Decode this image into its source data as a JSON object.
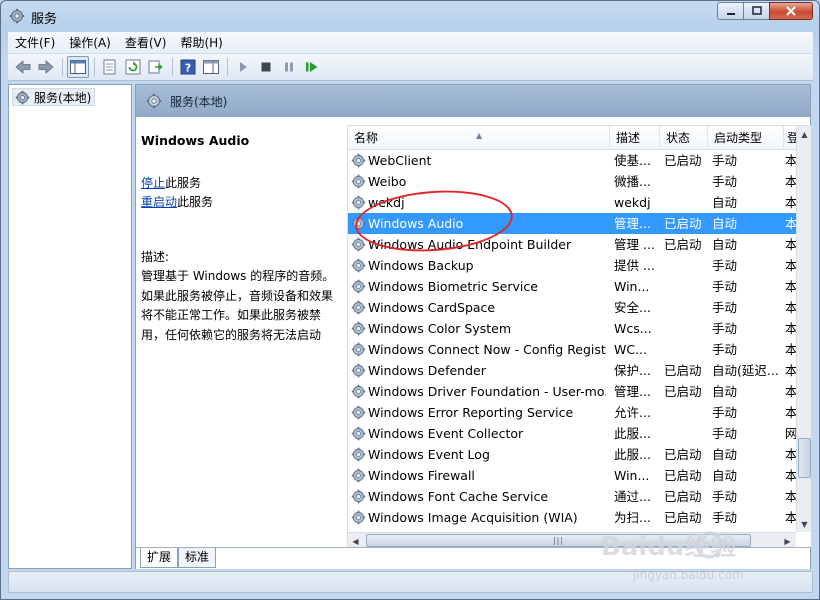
{
  "window": {
    "title": "服务"
  },
  "menu": [
    "文件(F)",
    "操作(A)",
    "查看(V)",
    "帮助(H)"
  ],
  "tree": {
    "root_label": "服务(本地)"
  },
  "right_header": {
    "label": "服务(本地)"
  },
  "detail": {
    "service_title": "Windows Audio",
    "stop_link": "停止",
    "stop_suffix": "此服务",
    "restart_link": "重启动",
    "restart_suffix": "此服务",
    "desc_label": "描述:",
    "desc_text": "管理基于 Windows 的程序的音频。如果此服务被停止，音频设备和效果将不能正常工作。如果此服务被禁用，任何依赖它的服务将无法启动"
  },
  "columns": {
    "name": "名称",
    "description": "描述",
    "status": "状态",
    "startup": "启动类型",
    "logon": "登"
  },
  "services": [
    {
      "name": "WebClient",
      "desc": "使基...",
      "status": "已启动",
      "startup": "手动",
      "logon": "本"
    },
    {
      "name": "Weibo",
      "desc": "微播...",
      "status": "",
      "startup": "手动",
      "logon": "本"
    },
    {
      "name": "wekdj",
      "desc": "wekdj",
      "status": "",
      "startup": "自动",
      "logon": "本"
    },
    {
      "name": "Windows Audio",
      "desc": "管理...",
      "status": "已启动",
      "startup": "自动",
      "logon": "本",
      "selected": true
    },
    {
      "name": "Windows Audio Endpoint Builder",
      "desc": "管理 ...",
      "status": "已启动",
      "startup": "自动",
      "logon": "本"
    },
    {
      "name": "Windows Backup",
      "desc": "提供 ...",
      "status": "",
      "startup": "手动",
      "logon": "本"
    },
    {
      "name": "Windows Biometric Service",
      "desc": "Win...",
      "status": "",
      "startup": "手动",
      "logon": "本"
    },
    {
      "name": "Windows CardSpace",
      "desc": "安全...",
      "status": "",
      "startup": "手动",
      "logon": "本"
    },
    {
      "name": "Windows Color System",
      "desc": "Wcs...",
      "status": "",
      "startup": "手动",
      "logon": "本"
    },
    {
      "name": "Windows Connect Now - Config Regist...",
      "desc": "WC...",
      "status": "",
      "startup": "手动",
      "logon": "本"
    },
    {
      "name": "Windows Defender",
      "desc": "保护...",
      "status": "已启动",
      "startup": "自动(延迟...",
      "logon": "本"
    },
    {
      "name": "Windows Driver Foundation - User-mo...",
      "desc": "管理...",
      "status": "已启动",
      "startup": "自动",
      "logon": "本"
    },
    {
      "name": "Windows Error Reporting Service",
      "desc": "允许...",
      "status": "",
      "startup": "手动",
      "logon": "本"
    },
    {
      "name": "Windows Event Collector",
      "desc": "此服...",
      "status": "",
      "startup": "手动",
      "logon": "网"
    },
    {
      "name": "Windows Event Log",
      "desc": "此服...",
      "status": "已启动",
      "startup": "自动",
      "logon": "本"
    },
    {
      "name": "Windows Firewall",
      "desc": "Win...",
      "status": "已启动",
      "startup": "自动",
      "logon": "本"
    },
    {
      "name": "Windows Font Cache Service",
      "desc": "通过...",
      "status": "已启动",
      "startup": "手动",
      "logon": "本"
    },
    {
      "name": "Windows Image Acquisition (WIA)",
      "desc": "为扫...",
      "status": "已启动",
      "startup": "手动",
      "logon": "本"
    }
  ],
  "tabs": [
    "扩展",
    "标准"
  ],
  "watermark": {
    "brand": "Baidu经验",
    "url": "jingyan.baidu.com"
  },
  "colors": {
    "selection": "#3399ff",
    "annotation": "#e0262a",
    "link": "#0645ad"
  }
}
